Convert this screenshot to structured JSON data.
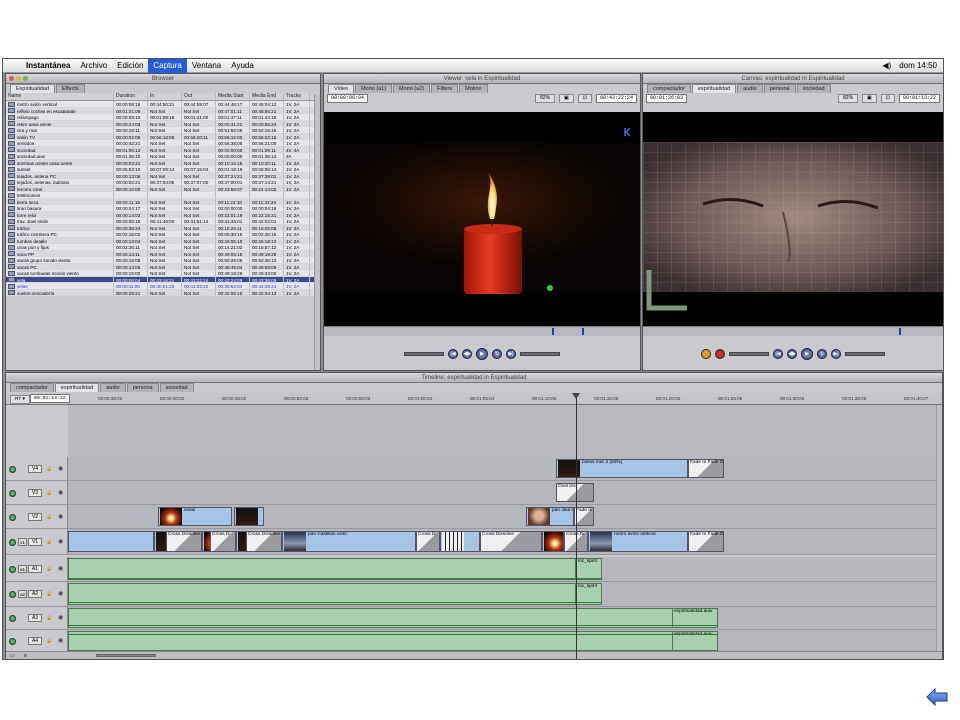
{
  "menubar": {
    "app": "Instantánea",
    "items": [
      "Archivo",
      "Edición",
      "Captura",
      "Ventana",
      "Ayuda"
    ],
    "active": "Captura",
    "clock": "dom 14:50"
  },
  "browser": {
    "title": "Browser",
    "tabs": [
      "Espiritualidad",
      "Effects"
    ],
    "columns": [
      "Name",
      "Duration",
      "In",
      "Out",
      "Media Start",
      "Media End",
      "Tracks"
    ],
    "rows": [
      [
        "rostro avión vertical",
        "00:00:08:16",
        "00:44:50:21",
        "00:44:59:07",
        "00:44:48:17",
        "00:45:04:12",
        "1V, 2A"
      ],
      [
        "reflejo coches en escaparate",
        "00:01:01:09",
        "Not Set",
        "Not Set",
        "00:47:01:11",
        "00:48:56:21",
        "1V, 2A"
      ],
      [
        "relámpago",
        "00:00:08:10",
        "00:01:59:18",
        "00:01:41:00",
        "00:01:37:11",
        "00:01:44:15",
        "1V, 2A"
      ],
      [
        "retiro pasa gente",
        "00:00:24:03",
        "Not Set",
        "Not Set",
        "00:00:31:22",
        "00:00:55:24",
        "1V, 2A"
      ],
      [
        "rica y mar",
        "00:00:19:11",
        "Not Set",
        "Not Set",
        "00:51:56:08",
        "00:52:15:18",
        "1V, 2A"
      ],
      [
        "salón TV",
        "00:00:02:06",
        "00:56:18:06",
        "00:56:20:11",
        "00:56:15:00",
        "00:56:23:15",
        "1V, 2A"
      ],
      [
        "sentidos",
        "00:00:42:21",
        "Not Set",
        "Not Set",
        "00:55:38:05",
        "00:56:21:00",
        "1V, 2A"
      ],
      [
        "sociedad",
        "00:01:06:12",
        "Not Set",
        "Not Set",
        "00:00:00:00",
        "00:01:06:11",
        "4V, 4A"
      ],
      [
        "sociedad.aiav",
        "00:01:35:15",
        "Not Set",
        "Not Set",
        "00:00:00:00",
        "00:01:35:14",
        "2A"
      ],
      [
        "sonrisas poster pasa gente",
        "00:00:03:21",
        "Not Set",
        "Not Set",
        "00:10:16:15",
        "00:10:20:11",
        "1V, 2A"
      ],
      [
        "sunset",
        "00:05:53:10",
        "00:07:09:14",
        "00:07:15:04",
        "00:01:16:16",
        "00:08:06:14",
        "1V, 2A"
      ],
      [
        "tejados, antena PC",
        "00:00:13:06",
        "Not Set",
        "Not Set",
        "00:37:24:21",
        "00:37:38:01",
        "1V, 2A"
      ],
      [
        "tejados, antenas, ladridos",
        "00:00:02:21",
        "00:37:04:05",
        "00:37:07:00",
        "00:37:00:01",
        "00:37:14:21",
        "1V, 2A"
      ],
      [
        "tercera cons",
        "00:00:10:00",
        "Not Set",
        "Not Set",
        "00:23:58:07",
        "00:24:14:02",
        "1V, 2A"
      ],
      [
        "testimonios",
        "",
        "",
        "",
        "",
        "",
        ""
      ],
      [
        "tierra seca",
        "00:00:11:15",
        "Not Set",
        "Not Set",
        "00:11:22:10",
        "00:11:33:24",
        "1V, 2A"
      ],
      [
        "tiran basura",
        "00:00:04:17",
        "Not Set",
        "Not Set",
        "00:00:00:00",
        "00:00:04:16",
        "1V, 2A"
      ],
      [
        "torre reloj",
        "00:00:14:03",
        "Not Set",
        "Not Set",
        "00:22:01:19",
        "00:22:15:21",
        "1V, 2A"
      ],
      [
        "trav. Jowl smile",
        "00:00:05:15",
        "00:41:46:00",
        "00:41:51:14",
        "00:41:45:01",
        "00:42:02:01",
        "1V, 2A"
      ],
      [
        "tráfico",
        "00:00:38:24",
        "Not Set",
        "Not Set",
        "00:15:26:11",
        "00:16:05:09",
        "1V, 2A"
      ],
      [
        "tráfico carretera PC",
        "00:02:15:02",
        "Not Set",
        "Not Set",
        "00:00:30:15",
        "00:02:45:16",
        "1V, 2A"
      ],
      [
        "tumbas detalle",
        "00:00:13:04",
        "Not Set",
        "Not Set",
        "00:26:05:10",
        "00:26:18:13",
        "1V, 2A"
      ],
      [
        "unas pon y fijos",
        "00:02:36:11",
        "Not Set",
        "Not Set",
        "00:14:21:02",
        "00:16:57:12",
        "1V, 2A"
      ],
      [
        "vaca PP",
        "00:00:13:11",
        "Not Set",
        "Not Set",
        "00:49:05:18",
        "00:49:18:28",
        "1V, 2A"
      ],
      [
        "vacas grupo sonido viento",
        "00:00:19:08",
        "Not Set",
        "Not Set",
        "00:50:26:06",
        "00:50:45:13",
        "1V, 2A"
      ],
      [
        "vacas PC",
        "00:00:14:06",
        "Not Set",
        "Not Set",
        "00:48:45:04",
        "00:48:59:09",
        "1V, 2A"
      ],
      [
        "vacas tumbadas sonido viento",
        "00:00:15:00",
        "Not Set",
        "Not Set",
        "00:49:18:26",
        "00:49:33:00",
        "1V, 2A"
      ],
      [
        "vela",
        "00:00:06:04",
        "00:43:16:21",
        "00:43:22:24",
        "00:42:24:09",
        "00:43:36:09",
        "1V, 2A"
      ],
      [
        "velas",
        "00:00:11:00",
        "00:40:51:23",
        "00:41:02:22",
        "00:39:52:04",
        "00:42:26:24",
        "1V, 2A"
      ],
      [
        "vuelos pescadería",
        "00:00:28:21",
        "Not Set",
        "Not Set",
        "00:32:06:10",
        "00:32:34:13",
        "1V, 2A"
      ]
    ],
    "selected_row": 27,
    "highlight_rows": [
      27,
      28
    ]
  },
  "viewer": {
    "title": "Viewer: vela in Espiritualidad",
    "tabs": [
      "Video",
      "Mono (a1)",
      "Mono (a2)",
      "Filters",
      "Motion"
    ],
    "timecode_duration": "00:00:06:04",
    "zoom": "82%",
    "timecode_current": "00:43:22:24"
  },
  "canvas": {
    "title": "Canvas: espiritualidad in Espiritualidad",
    "tabs": [
      "compactador",
      "espiritualidad",
      "audio",
      "persona",
      "sociedad"
    ],
    "timecode_duration": "00:01:26:03",
    "zoom": "82%",
    "timecode_current": "00:01:13:22"
  },
  "timeline": {
    "title": "Timeline: espiritualidad in Espiritualidad",
    "tabs": [
      "compactador",
      "espiritualidad",
      "audio",
      "persona",
      "sociedad"
    ],
    "current_timecode": "00:01:13:22",
    "ruler": [
      "00:00:35:02",
      "00:00:40:02",
      "00:00:45:02",
      "00:00:50:03",
      "00:00:55:03",
      "00:01:00:04",
      "00:01:05:04",
      "00:01:10:05",
      "00:01:15:05",
      "00:01:20:05",
      "00:01:25:06",
      "00:01:30:06",
      "00:01:35:06",
      "00:01:40:07"
    ],
    "video_tracks": [
      "V4",
      "V3",
      "V2",
      "V1"
    ],
    "audio_tracks": [
      "A1",
      "A2",
      "A3",
      "A4"
    ],
    "source_video": "v1",
    "source_audio": [
      "a1",
      "a2"
    ],
    "clips": {
      "v4_clip": "brillos mar 2 (50%)",
      "v4_trans": "Fade In Fade O",
      "v3_trans": "Oval Iris",
      "v2_clip_a": "velas",
      "v2_clip_b": "pan Jaul s",
      "v2_trans": "Fade In",
      "v1_trans_1": "Cross Dissolve",
      "v1_trans_2": "Cross Di",
      "v1_trans_3": "Cross Dissolve",
      "v1_clip_cielo": "pan Castillas cielo",
      "v1_trans_4": "Cross Di",
      "v1_trans_5": "Cross Dissolve",
      "v1_trans_6": "Cross Di",
      "v1_clip_rostro": "rostro avión vertical",
      "v1_trans_end": "Fade In Fade O",
      "a1_clip": "loc_spirit",
      "a2_clip": "loc_spirit",
      "a3_clip": "espiritualidad.aiav",
      "a4_clip": "espiritualidad.aiav"
    }
  },
  "colors": {
    "selection": "#2a5bd7",
    "video_clip": "#a6c4e6",
    "audio_clip": "#a8cfae"
  },
  "icons": {
    "back": "back-arrow-icon",
    "apple": "apple-icon"
  }
}
